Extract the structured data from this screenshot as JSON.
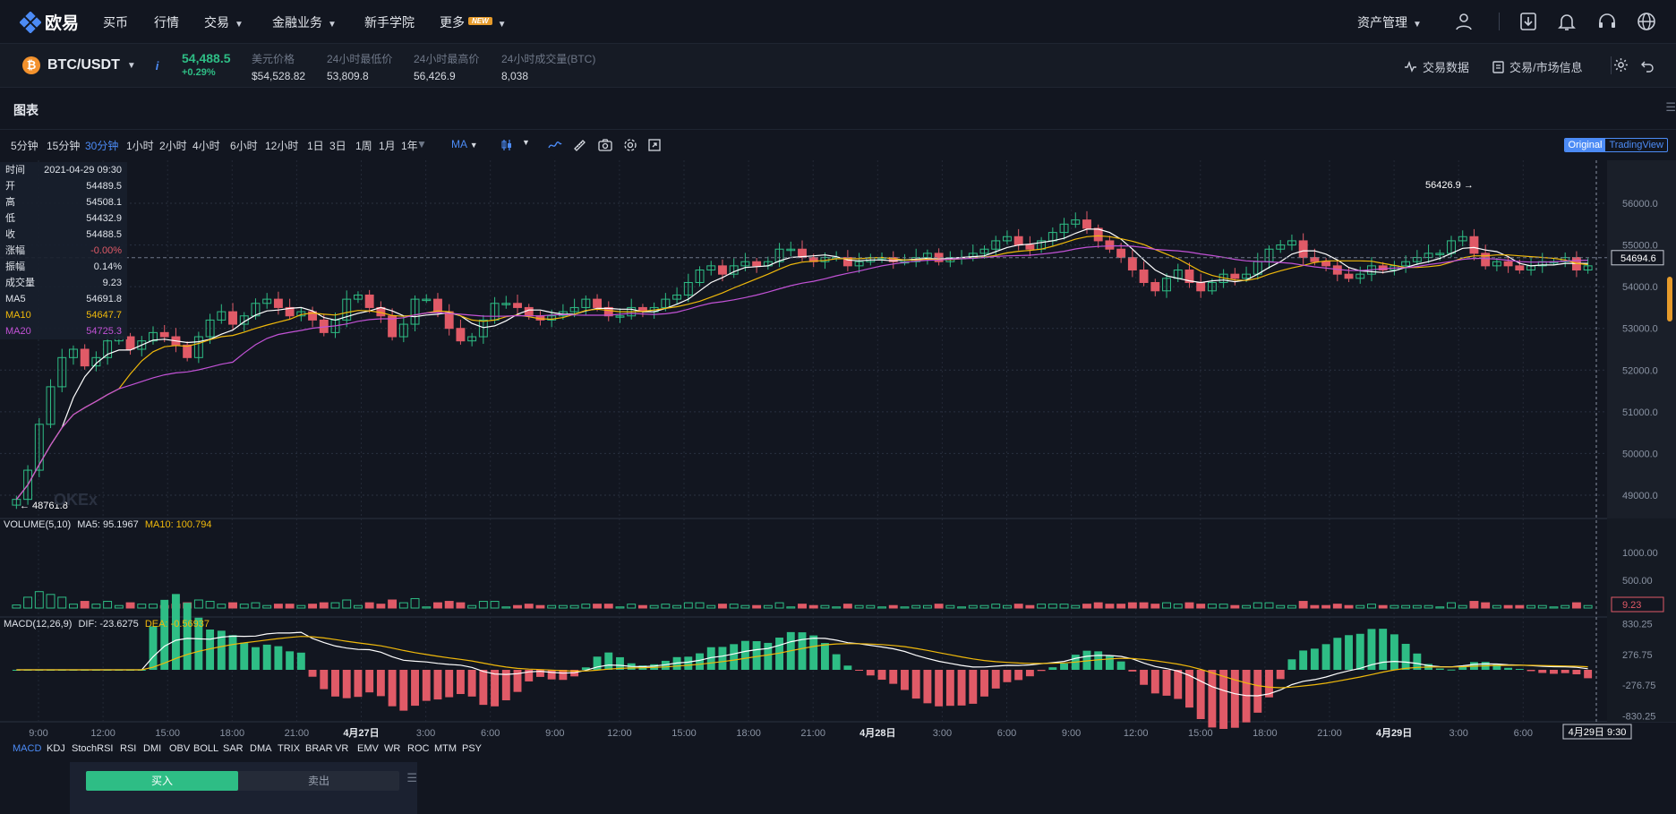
{
  "nav": {
    "logo": "欧易",
    "items": [
      "买币",
      "行情",
      "交易",
      "金融业务",
      "新手学院",
      "更多"
    ],
    "new_badge": "NEW",
    "asset_mgmt": "资产管理"
  },
  "ticker": {
    "pair": "BTC/USDT",
    "price": "54,488.5",
    "change": "+0.29%",
    "stats": [
      {
        "label": "美元价格",
        "value": "$54,528.82"
      },
      {
        "label": "24小时最低价",
        "value": "53,809.8"
      },
      {
        "label": "24小时最高价",
        "value": "56,426.9"
      },
      {
        "label": "24小时成交量(BTC)",
        "value": "8,038"
      }
    ],
    "tools": [
      "交易数据",
      "交易/市场信息"
    ]
  },
  "section_title": "图表",
  "toolbar": {
    "timeframes": [
      "5分钟",
      "15分钟",
      "30分钟",
      "1小时",
      "2小时",
      "4小时",
      "6小时",
      "12小时",
      "1日",
      "3日",
      "1周",
      "1月",
      "1年"
    ],
    "active": "30分钟",
    "indicator": "MA",
    "source_on": "Original",
    "source_off": "TradingView"
  },
  "ohlc": [
    {
      "k": "时间",
      "v": "2021-04-29 09:30"
    },
    {
      "k": "开",
      "v": "54489.5"
    },
    {
      "k": "高",
      "v": "54508.1"
    },
    {
      "k": "低",
      "v": "54432.9"
    },
    {
      "k": "收",
      "v": "54488.5"
    },
    {
      "k": "涨幅",
      "v": "-0.00%"
    },
    {
      "k": "振幅",
      "v": "0.14%"
    },
    {
      "k": "成交量",
      "v": "9.23"
    },
    {
      "k": "MA5",
      "v": "54691.8"
    },
    {
      "k": "MA10",
      "v": "54647.7"
    },
    {
      "k": "MA20",
      "v": "54725.3"
    }
  ],
  "colors": {
    "up": "#2ebd85",
    "down": "#e05a67",
    "ma5": "#ffffff",
    "ma10": "#f0b90b",
    "ma20": "#c252d6",
    "accent": "#4c8bf5"
  },
  "volume_label": {
    "title": "VOLUME(5,10)",
    "ma5": "MA5: 95.1967",
    "ma10": "MA10: 100.794"
  },
  "macd_label": {
    "title": "MACD(12,26,9)",
    "dif": "DIF: -23.6275",
    "dea": "DEA: -0.56937"
  },
  "chart_data": {
    "type": "candlestick",
    "price_axis": [
      "56000.0",
      "55000.0",
      "54000.0",
      "53000.0",
      "52000.0",
      "51000.0",
      "50000.0",
      "49000.0"
    ],
    "volume_axis": [
      "1000.00",
      "500.00"
    ],
    "macd_axis": [
      "830.25",
      "276.75",
      "-276.75",
      "-830.25"
    ],
    "time_labels": [
      "9:00",
      "12:00",
      "15:00",
      "18:00",
      "21:00",
      "4月27日",
      "3:00",
      "6:00",
      "9:00",
      "12:00",
      "15:00",
      "18:00",
      "21:00",
      "4月28日",
      "3:00",
      "6:00",
      "9:00",
      "12:00",
      "15:00",
      "18:00",
      "21:00",
      "4月29日",
      "3:00",
      "6:00"
    ],
    "current_price": "54694.6",
    "high_label": "56426.9",
    "low_label": "48761.8",
    "volume_current": "9.23",
    "cursor_time": "4月29日 9:30",
    "close_series": [
      48900,
      49600,
      50700,
      51600,
      52300,
      52500,
      52100,
      52300,
      52700,
      52800,
      52500,
      52700,
      52900,
      52800,
      52600,
      52300,
      52800,
      53200,
      53400,
      53100,
      53300,
      53600,
      53700,
      53500,
      53300,
      53400,
      53200,
      52900,
      53200,
      53700,
      53800,
      53500,
      53300,
      52800,
      53100,
      53700,
      53700,
      53400,
      53000,
      52700,
      52800,
      53200,
      53600,
      53600,
      53500,
      53300,
      53200,
      53300,
      53400,
      53500,
      53700,
      53500,
      53300,
      53300,
      53500,
      53400,
      53500,
      53700,
      53800,
      54100,
      54400,
      54500,
      54300,
      54500,
      54600,
      54500,
      54600,
      54900,
      54900,
      54700,
      54600,
      54700,
      54700,
      54500,
      54600,
      54700,
      54700,
      54600,
      54600,
      54700,
      54800,
      54600,
      54700,
      54700,
      54800,
      54900,
      55100,
      55200,
      55000,
      54900,
      55100,
      55300,
      55500,
      55600,
      55400,
      55100,
      54900,
      54700,
      54400,
      54100,
      53900,
      54200,
      54400,
      54100,
      53900,
      54100,
      54300,
      54200,
      54300,
      54600,
      54900,
      55000,
      55100,
      54700,
      54600,
      54500,
      54300,
      54200,
      54300,
      54500,
      54400,
      54500,
      54600,
      54700,
      54800,
      54800,
      55100,
      55200,
      54800,
      54500,
      54600,
      54500,
      54400,
      54500,
      54600,
      54600,
      54700,
      54400,
      54500
    ]
  },
  "indicator_tabs": [
    "MACD",
    "KDJ",
    "StochRSI",
    "RSI",
    "DMI",
    "OBV",
    "BOLL",
    "SAR",
    "DMA",
    "TRIX",
    "BRAR",
    "VR",
    "EMV",
    "WR",
    "ROC",
    "MTM",
    "PSY"
  ],
  "trade": {
    "buy": "买入",
    "sell": "卖出"
  }
}
